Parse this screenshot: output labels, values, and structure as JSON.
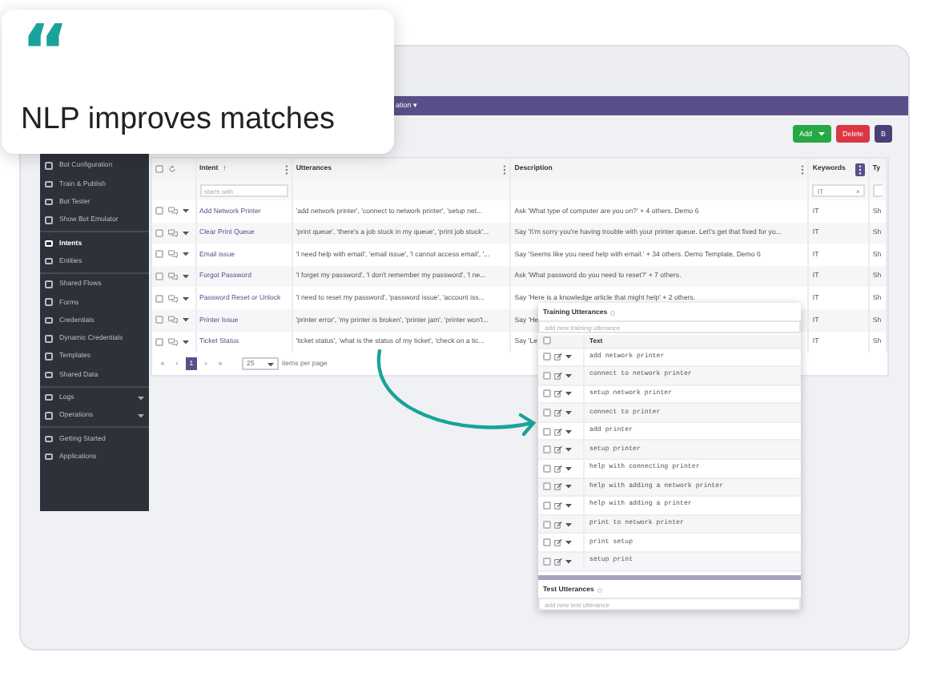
{
  "callout": {
    "quote_mark": "“",
    "text": "NLP improves matches"
  },
  "header_bar": {
    "text": "ation ▾"
  },
  "toolbar": [
    {
      "label": "Add",
      "kind": "split-success"
    },
    {
      "label": "Delete",
      "kind": "danger"
    },
    {
      "label": "B",
      "kind": "primary"
    }
  ],
  "sidebar": {
    "groups": [
      [
        {
          "label": "Bot Configuration",
          "selected": false
        },
        {
          "label": "Train & Publish",
          "selected": false
        },
        {
          "label": "Bot Tester",
          "selected": false
        },
        {
          "label": "Show Bot Emulator",
          "selected": false
        }
      ],
      [
        {
          "label": "Intents",
          "selected": true
        },
        {
          "label": "Entities",
          "selected": false
        }
      ],
      [
        {
          "label": "Shared Flows",
          "selected": false
        },
        {
          "label": "Forms",
          "selected": false
        },
        {
          "label": "Credentials",
          "selected": false
        },
        {
          "label": "Dynamic Credentials",
          "selected": false
        },
        {
          "label": "Templates",
          "selected": false
        },
        {
          "label": "Shared Data",
          "selected": false
        }
      ],
      [
        {
          "label": "Logs",
          "selected": false,
          "expandable": true
        },
        {
          "label": "Operations",
          "selected": false,
          "expandable": true
        }
      ],
      [
        {
          "label": "Getting Started",
          "selected": false
        },
        {
          "label": "Applications",
          "selected": false
        }
      ]
    ]
  },
  "table": {
    "select_all_checked": false,
    "columns": [
      {
        "label": "Intent",
        "sort": "↑",
        "menu": true,
        "menu_highlighted": false
      },
      {
        "label": "Utterances",
        "menu": true,
        "menu_highlighted": false
      },
      {
        "label": "Description",
        "menu": true,
        "menu_highlighted": false
      },
      {
        "label": "Keywords",
        "menu": true,
        "menu_highlighted": true
      },
      {
        "label": "Ty",
        "menu": false
      }
    ],
    "filters": {
      "intent": {
        "placeholder": "starts with"
      },
      "keywords": {
        "value": "IT",
        "clear": "×"
      }
    },
    "rows": [
      {
        "checked": false,
        "intent": "Add Network Printer",
        "utterances": "'add network printer', 'connect to network printer', 'setup net...",
        "description": "Ask 'What type of computer are you on?' + 4 others. Demo 6",
        "keywords": "IT",
        "type": "Sh"
      },
      {
        "checked": false,
        "intent": "Clear Print Queue",
        "utterances": "'print queue', 'there's a job stuck in my queue', 'print job stuck'...",
        "description": "Say 'I\\'m sorry you're having trouble with your printer queue. Let\\'s get that fixed for yo...",
        "keywords": "IT",
        "type": "Sh"
      },
      {
        "checked": false,
        "intent": "Email issue",
        "utterances": "'I need help with email', 'email issue', 'I cannot access email', '...",
        "description": "Say 'Seems like you need help with email.' + 34 others. Demo Template, Demo 6",
        "keywords": "IT",
        "type": "Sh"
      },
      {
        "checked": false,
        "intent": "Forgot Password",
        "utterances": "'I forget my password', 'I don't remember my password', 'I ne...",
        "description": "Ask 'What password do you need to reset?' + 7 others.",
        "keywords": "IT",
        "type": "Sh"
      },
      {
        "checked": false,
        "intent": "Password Reset or Unlock",
        "utterances": "'I need to reset my password', 'password issue', 'account iss...",
        "description": "Say 'Here is a knowledge article that might help' + 2 others.",
        "keywords": "IT",
        "type": "Sh"
      },
      {
        "checked": false,
        "intent": "Printer Issue",
        "utterances": "'printer error', 'my printer is broken', 'printer jam', 'printer won't...",
        "description": "Say 'He",
        "keywords": "IT",
        "type": "Sh"
      },
      {
        "checked": false,
        "intent": "Ticket Status",
        "utterances": "'ticket status', 'what is the status of my ticket', 'check on a tic...",
        "description": "Say 'Le",
        "keywords": "IT",
        "type": "Sh"
      }
    ],
    "pagination": {
      "first": "«",
      "prev": "‹",
      "pages": [
        {
          "label": "1",
          "selected": true
        }
      ],
      "next": "›",
      "last": "»",
      "page_size": "25",
      "suffix": "items per page"
    }
  },
  "popup": {
    "title": "Training Utterances",
    "placeholder": "add new training utterance",
    "column": "Text",
    "select_all_checked": false,
    "rows": [
      {
        "text": "add network printer",
        "checked": false
      },
      {
        "text": "connect to network printer",
        "checked": false
      },
      {
        "text": "setup network printer",
        "checked": false
      },
      {
        "text": "connect to printer",
        "checked": false
      },
      {
        "text": "add printer",
        "checked": false
      },
      {
        "text": "setup printer",
        "checked": false
      },
      {
        "text": "help with connecting printer",
        "checked": false
      },
      {
        "text": "help with adding a network printer",
        "checked": false
      },
      {
        "text": "help with adding a printer",
        "checked": false
      },
      {
        "text": "print to network printer",
        "checked": false
      },
      {
        "text": "print setup",
        "checked": false
      },
      {
        "text": "setup print",
        "checked": false
      }
    ],
    "test_title": "Test Utterances",
    "test_placeholder": "add new test utterance"
  }
}
